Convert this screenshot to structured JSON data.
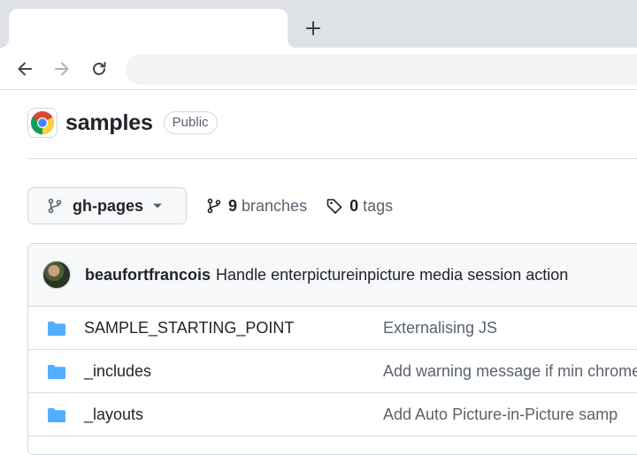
{
  "browser": {
    "new_tab_icon": "plus-icon",
    "back_icon": "arrow-left-icon",
    "forward_icon": "arrow-right-icon",
    "reload_icon": "reload-icon",
    "address": ""
  },
  "repo": {
    "name": "samples",
    "visibility": "Public",
    "logo_icon": "chrome-logo-icon"
  },
  "branch_bar": {
    "current_branch": "gh-pages",
    "branches_count": "9",
    "branches_label": "branches",
    "tags_count": "0",
    "tags_label": "tags"
  },
  "latest_commit": {
    "author": "beaufortfrancois",
    "message": "Handle enterpictureinpicture media session action"
  },
  "files": [
    {
      "name": "SAMPLE_STARTING_POINT",
      "message": "Externalising JS",
      "type": "folder"
    },
    {
      "name": "_includes",
      "message": "Add warning message if min chrome",
      "type": "folder"
    },
    {
      "name": "_layouts",
      "message": "Add Auto Picture-in-Picture samp",
      "type": "folder"
    }
  ],
  "colors": {
    "folder": "#54aeff",
    "muted_text": "#59636e",
    "tabstrip": "#dee1e6"
  }
}
